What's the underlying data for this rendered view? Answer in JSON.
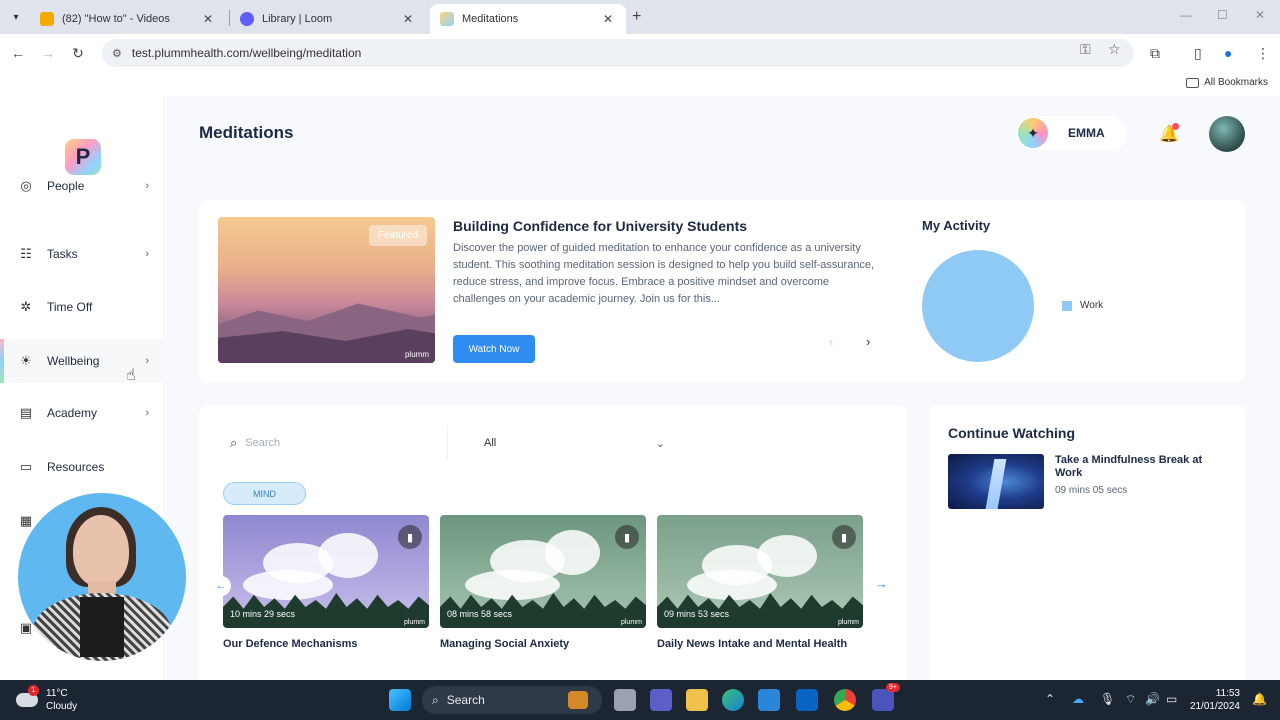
{
  "browser": {
    "tabs": [
      {
        "title": "(82) \"How to\" - Videos",
        "active": false,
        "favicon_color": "#f2a900"
      },
      {
        "title": "Library | Loom",
        "active": false,
        "favicon_color": "#625df5"
      },
      {
        "title": "Meditations",
        "active": true,
        "favicon_color": "#8fd3ff"
      }
    ],
    "url": "test.plummhealth.com/wellbeing/meditation",
    "bookmarks_label": "All Bookmarks"
  },
  "sidebar": {
    "logo_letter": "P",
    "items": [
      {
        "label": "People",
        "icon": "globe-icon",
        "has_chevron": true
      },
      {
        "label": "Tasks",
        "icon": "checklist-icon",
        "has_chevron": true
      },
      {
        "label": "Time Off",
        "icon": "palm-tree-icon",
        "has_chevron": false
      },
      {
        "label": "Wellbeing",
        "icon": "sun-icon",
        "has_chevron": true,
        "active": true
      },
      {
        "label": "Academy",
        "icon": "book-icon",
        "has_chevron": true
      },
      {
        "label": "Resources",
        "icon": "folder-icon",
        "has_chevron": false
      }
    ]
  },
  "header": {
    "page_title": "Meditations",
    "user_name": "EMMA"
  },
  "featured": {
    "badge": "Featured",
    "watermark": "plumm",
    "title": "Building Confidence for University Students",
    "description": "Discover the power of guided meditation to enhance your confidence as a university student. This soothing meditation session is designed to help you build self-assurance, reduce stress, and improve focus. Embrace a positive mindset and overcome challenges on your academic journey. Join us for this...",
    "button_label": "Watch Now"
  },
  "activity": {
    "title": "My Activity",
    "legend_label": "Work",
    "color": "#8fcaf5"
  },
  "chart_data": {
    "type": "pie",
    "categories": [
      "Work"
    ],
    "values": [
      100
    ]
  },
  "library": {
    "search_placeholder": "Search",
    "filter_value": "All",
    "tag": "MIND",
    "videos": [
      {
        "title": "Our Defence Mechanisms",
        "duration": "10 mins 29 secs",
        "sky": "#9b94d6"
      },
      {
        "title": "Managing Social Anxiety",
        "duration": "08 mins 58 secs",
        "sky": "#6f9a82"
      },
      {
        "title": "Daily News Intake and Mental Health",
        "duration": "09 mins 53 secs",
        "sky": "#7fa391"
      }
    ],
    "watermark": "plumm"
  },
  "continue_watching": {
    "title": "Continue Watching",
    "video_title": "Take a Mindfulness Break at Work",
    "duration": "09 mins 05 secs"
  },
  "taskbar": {
    "temperature": "11°C",
    "condition": "Cloudy",
    "weather_badge": "1",
    "search_label": "Search",
    "time": "11:53",
    "date": "21/01/2024",
    "teams_badge": "9+"
  }
}
